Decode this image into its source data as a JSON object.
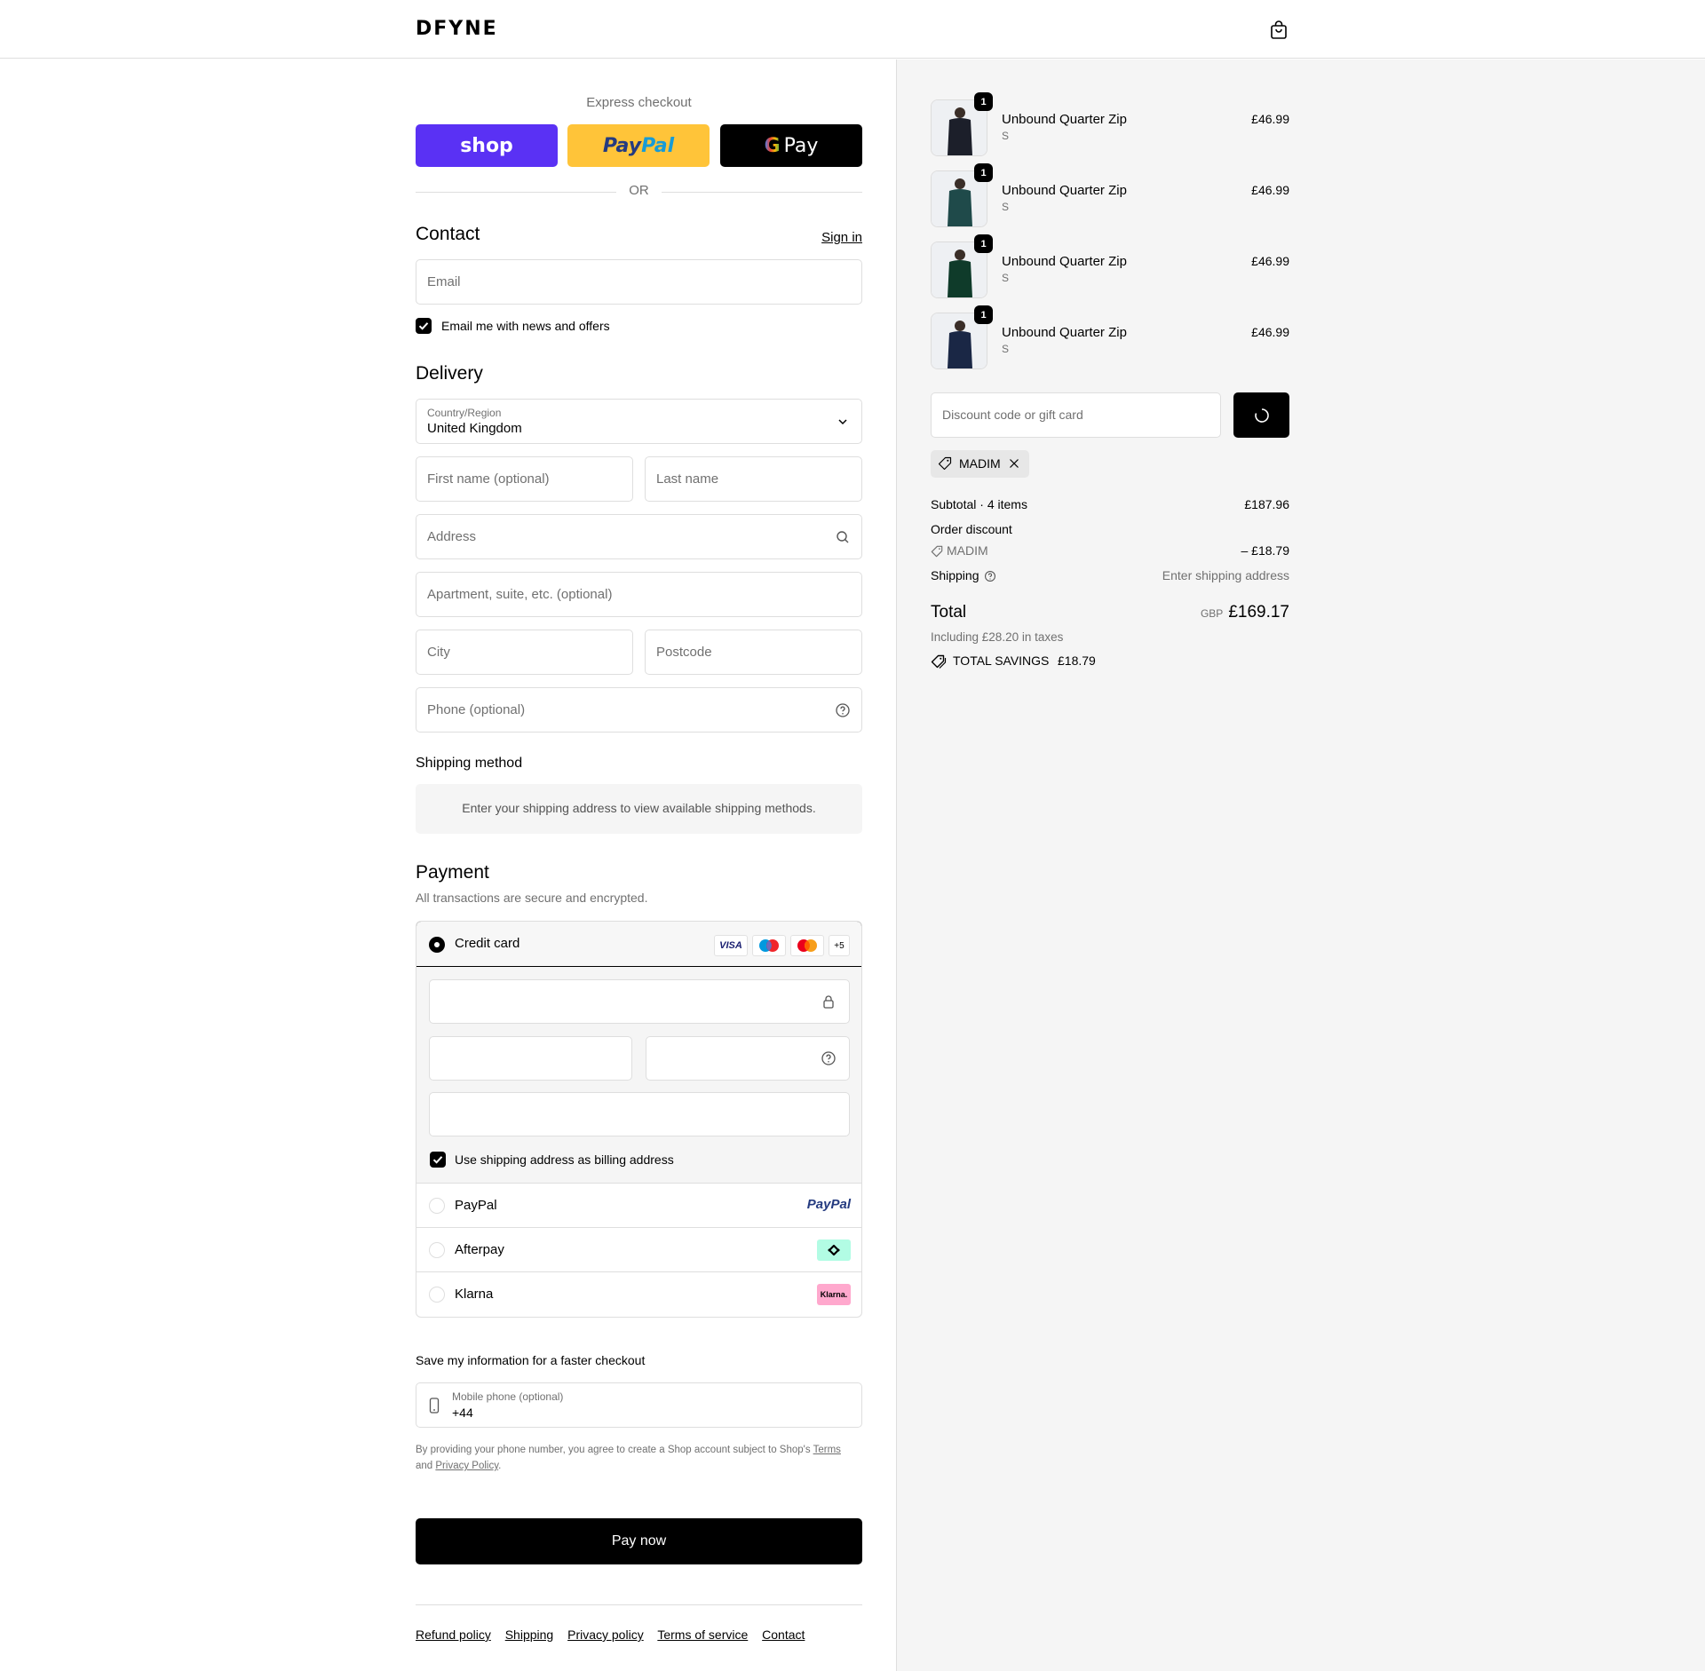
{
  "header": {
    "brand": "DFYNE"
  },
  "express": {
    "title": "Express checkout",
    "shop_label": "shop",
    "paypal_label_1": "Pay",
    "paypal_label_2": "Pal",
    "gpay_g": "G",
    "gpay_label": "Pay",
    "or_label": "OR"
  },
  "contact": {
    "title": "Contact",
    "sign_in": "Sign in",
    "email_placeholder": "Email",
    "newsletter_label": "Email me with news and offers"
  },
  "delivery": {
    "title": "Delivery",
    "country_label": "Country/Region",
    "country_value": "United Kingdom",
    "first_name_placeholder": "First name (optional)",
    "last_name_placeholder": "Last name",
    "address_placeholder": "Address",
    "apartment_placeholder": "Apartment, suite, etc. (optional)",
    "city_placeholder": "City",
    "postcode_placeholder": "Postcode",
    "phone_placeholder": "Phone (optional)"
  },
  "shipping_method": {
    "title": "Shipping method",
    "message": "Enter your shipping address to view available shipping methods."
  },
  "payment": {
    "title": "Payment",
    "subtitle": "All transactions are secure and encrypted.",
    "credit_card_label": "Credit card",
    "card_logos": [
      "VISA",
      "Maestro",
      "Mastercard",
      "+5"
    ],
    "more_cards": "+5",
    "visa_text": "VISA",
    "billing_label": "Use shipping address as billing address",
    "methods": [
      {
        "label": "PayPal",
        "logo": "PayPal"
      },
      {
        "label": "Afterpay",
        "logo": "afterpay-icon"
      },
      {
        "label": "Klarna",
        "logo": "Klarna."
      }
    ]
  },
  "save_info": {
    "title": "Save my information for a faster checkout",
    "mobile_label": "Mobile phone (optional)",
    "mobile_value": "+44",
    "legal_1": "By providing your phone number, you agree to create a Shop account subject to Shop's ",
    "legal_terms": "Terms",
    "legal_2": "and ",
    "legal_privacy": "Privacy Policy",
    "legal_3": "."
  },
  "pay_now": "Pay now",
  "footer": [
    "Refund policy",
    "Shipping",
    "Privacy policy",
    "Terms of service",
    "Contact"
  ],
  "cart": {
    "items": [
      {
        "name": "Unbound Quarter Zip",
        "variant": "S",
        "price": "£46.99",
        "qty": "1",
        "color": "#1c1f2a"
      },
      {
        "name": "Unbound Quarter Zip",
        "variant": "S",
        "price": "£46.99",
        "qty": "1",
        "color": "#1f4a4a"
      },
      {
        "name": "Unbound Quarter Zip",
        "variant": "S",
        "price": "£46.99",
        "qty": "1",
        "color": "#0f3b2a"
      },
      {
        "name": "Unbound Quarter Zip",
        "variant": "S",
        "price": "£46.99",
        "qty": "1",
        "color": "#1a2745"
      }
    ],
    "discount_placeholder": "Discount code or gift card",
    "applied_code": "MADIM",
    "subtotal_label": "Subtotal · 4 items",
    "subtotal_value": "£187.96",
    "order_discount_label": "Order discount",
    "discount_code": "MADIM",
    "discount_value": "– £18.79",
    "shipping_label": "Shipping",
    "shipping_value": "Enter shipping address",
    "total_label": "Total",
    "currency": "GBP",
    "total_value": "£169.17",
    "taxes_note": "Including £28.20 in taxes",
    "savings_label": "TOTAL SAVINGS",
    "savings_value": "£18.79"
  }
}
